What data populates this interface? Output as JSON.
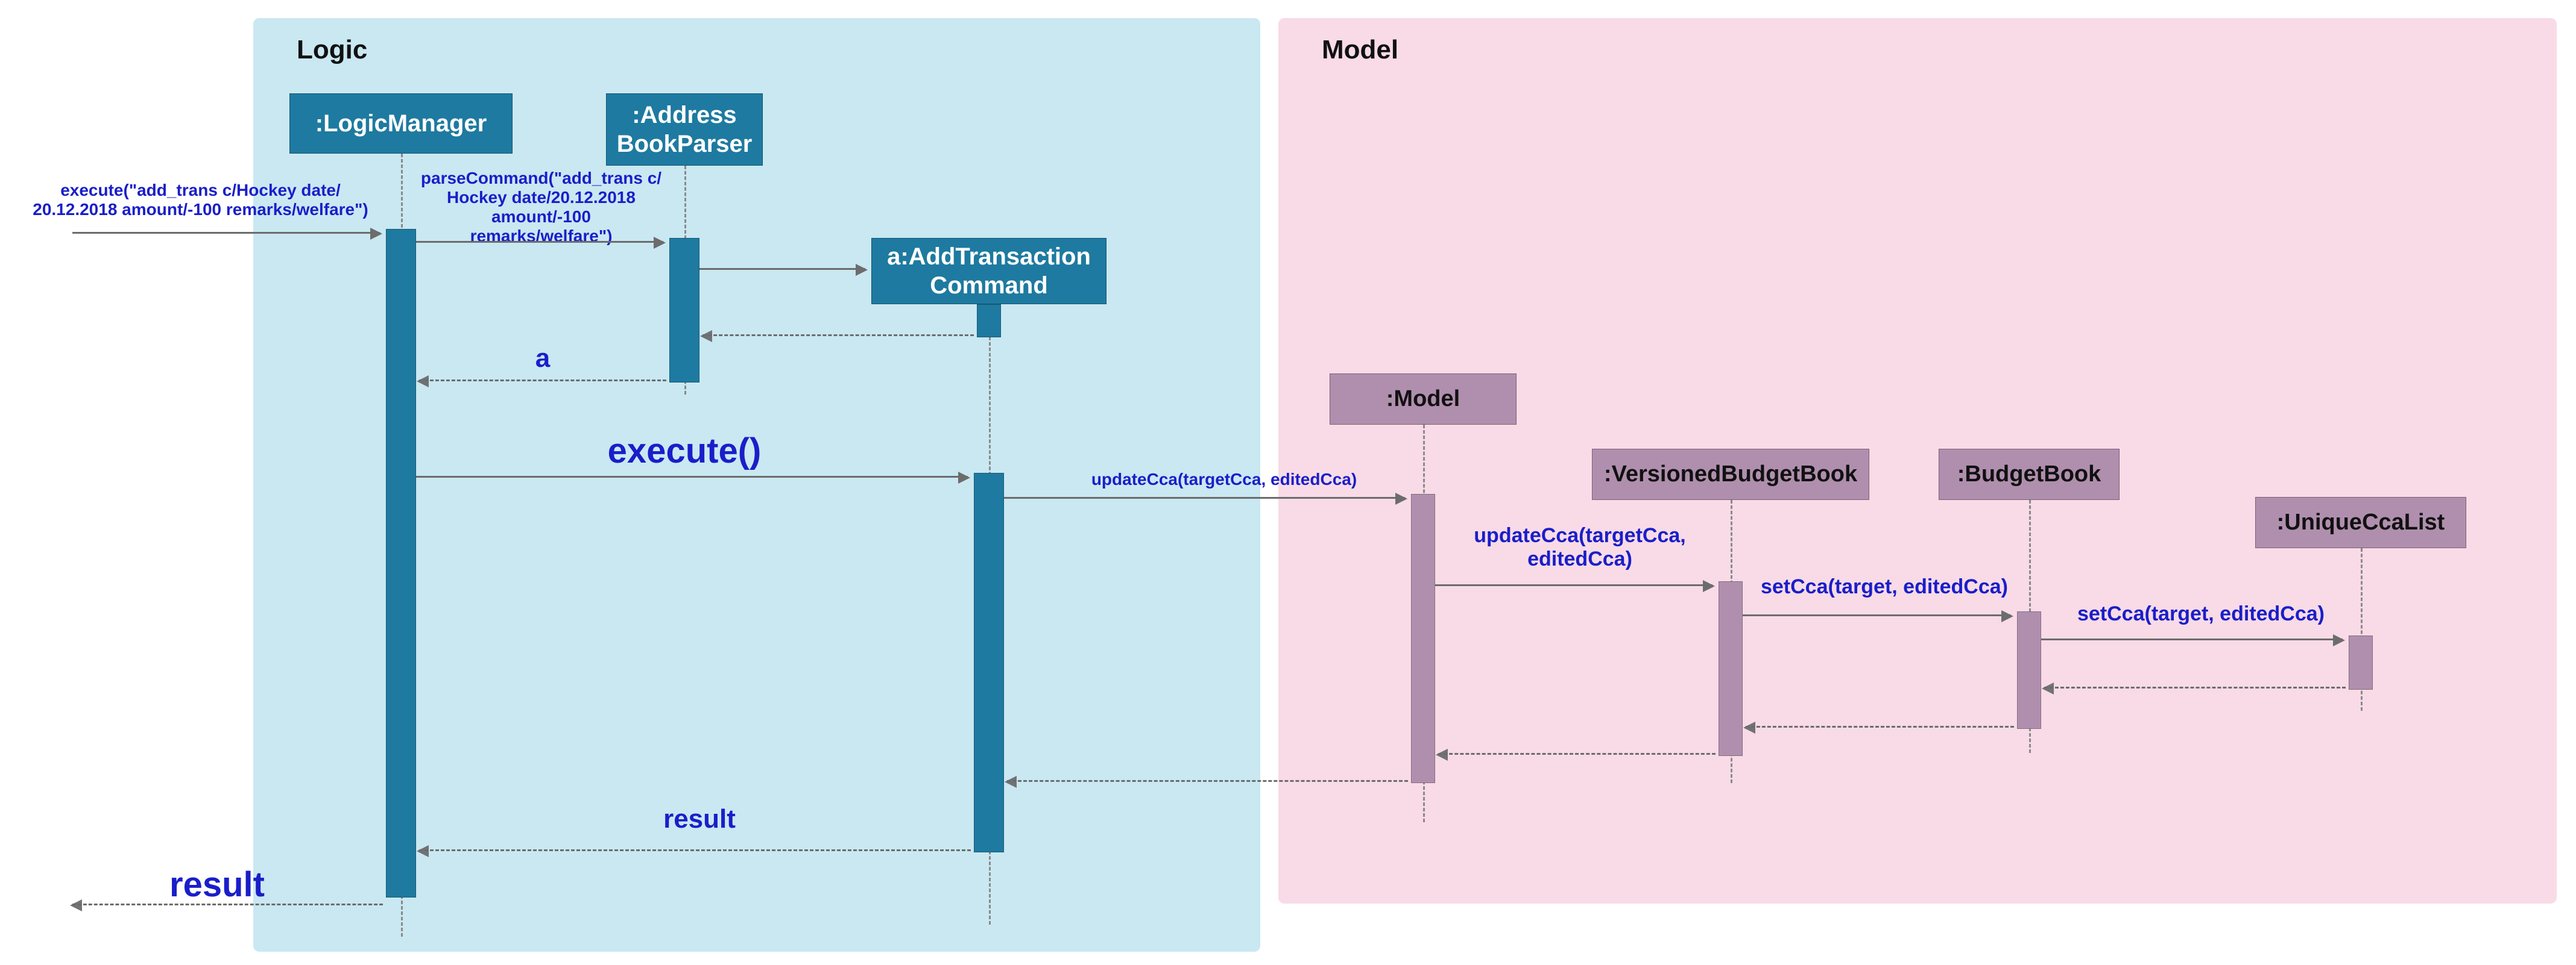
{
  "regions": {
    "logic": {
      "label": "Logic"
    },
    "model": {
      "label": "Model"
    }
  },
  "participants": {
    "logicManager": {
      "label": ":LogicManager"
    },
    "addressBookParser": {
      "label": ":Address\nBookParser"
    },
    "addTransactionCommand": {
      "label": "a:AddTransaction\nCommand"
    },
    "model": {
      "label": ":Model"
    },
    "versionedBudgetBook": {
      "label": ":VersionedBudgetBook"
    },
    "budgetBook": {
      "label": ":BudgetBook"
    },
    "uniqueCcaList": {
      "label": ":UniqueCcaList"
    }
  },
  "messages": {
    "execInitial": "execute(\"add_trans c/Hockey date/\n20.12.2018 amount/-100 remarks/welfare\")",
    "parseCommand": "parseCommand(\"add_trans c/\nHockey date/20.12.2018\namount/-100 remarks/welfare\")",
    "returnA": "a",
    "executeCall": "execute()",
    "updateCcaOuter": "updateCca(targetCca, editedCca)",
    "updateCcaInner": "updateCca(targetCca,\neditedCca)",
    "setCca1": "setCca(target, editedCca)",
    "setCca2": "setCca(target, editedCca)",
    "resultInner": "result",
    "resultOuter": "result"
  },
  "chart_data": {
    "type": "sequence-diagram",
    "fragments": [
      {
        "name": "Logic",
        "participants": [
          "LogicManager",
          "AddressBookParser",
          "AddTransactionCommand"
        ]
      },
      {
        "name": "Model",
        "participants": [
          "Model",
          "VersionedBudgetBook",
          "BudgetBook",
          "UniqueCcaList"
        ]
      }
    ],
    "participants": [
      {
        "id": "LogicManager",
        "label": ":LogicManager"
      },
      {
        "id": "AddressBookParser",
        "label": ":Address BookParser"
      },
      {
        "id": "AddTransactionCommand",
        "label": "a:AddTransaction Command"
      },
      {
        "id": "Model",
        "label": ":Model"
      },
      {
        "id": "VersionedBudgetBook",
        "label": ":VersionedBudgetBook"
      },
      {
        "id": "BudgetBook",
        "label": ":BudgetBook"
      },
      {
        "id": "UniqueCcaList",
        "label": ":UniqueCcaList"
      }
    ],
    "messages": [
      {
        "from": "external",
        "to": "LogicManager",
        "label": "execute(\"add_trans c/Hockey date/20.12.2018 amount/-100 remarks/welfare\")",
        "style": "call"
      },
      {
        "from": "LogicManager",
        "to": "AddressBookParser",
        "label": "parseCommand(\"add_trans c/Hockey date/20.12.2018 amount/-100 remarks/welfare\")",
        "style": "call"
      },
      {
        "from": "AddressBookParser",
        "to": "AddTransactionCommand",
        "label": "",
        "style": "create"
      },
      {
        "from": "AddTransactionCommand",
        "to": "AddressBookParser",
        "label": "",
        "style": "return"
      },
      {
        "from": "AddressBookParser",
        "to": "LogicManager",
        "label": "a",
        "style": "return"
      },
      {
        "from": "LogicManager",
        "to": "AddTransactionCommand",
        "label": "execute()",
        "style": "call"
      },
      {
        "from": "AddTransactionCommand",
        "to": "Model",
        "label": "updateCca(targetCca, editedCca)",
        "style": "call"
      },
      {
        "from": "Model",
        "to": "VersionedBudgetBook",
        "label": "updateCca(targetCca, editedCca)",
        "style": "call"
      },
      {
        "from": "VersionedBudgetBook",
        "to": "BudgetBook",
        "label": "setCca(target, editedCca)",
        "style": "call"
      },
      {
        "from": "BudgetBook",
        "to": "UniqueCcaList",
        "label": "setCca(target, editedCca)",
        "style": "call"
      },
      {
        "from": "UniqueCcaList",
        "to": "BudgetBook",
        "label": "",
        "style": "return"
      },
      {
        "from": "BudgetBook",
        "to": "VersionedBudgetBook",
        "label": "",
        "style": "return"
      },
      {
        "from": "VersionedBudgetBook",
        "to": "Model",
        "label": "",
        "style": "return"
      },
      {
        "from": "Model",
        "to": "AddTransactionCommand",
        "label": "",
        "style": "return"
      },
      {
        "from": "AddTransactionCommand",
        "to": "LogicManager",
        "label": "result",
        "style": "return"
      },
      {
        "from": "LogicManager",
        "to": "external",
        "label": "result",
        "style": "return"
      }
    ]
  }
}
